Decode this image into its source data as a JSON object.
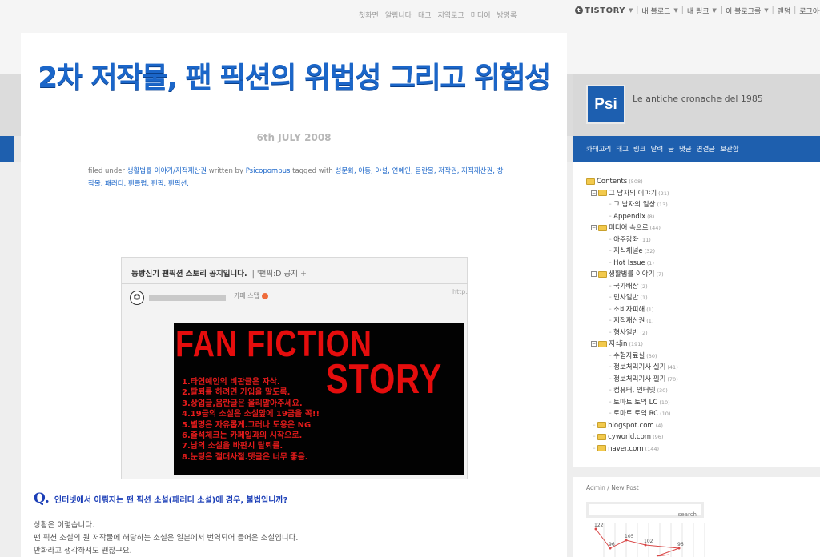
{
  "top_nav": [
    "첫화면",
    "알림니다",
    "태그",
    "지역로그",
    "미디어",
    "방명록"
  ],
  "tistory_bar": {
    "logo": "TISTORY",
    "items": [
      "내 블로그",
      "내 링크",
      "이 블로그를",
      "랜덤",
      "로그아웃"
    ]
  },
  "post": {
    "title": "2차 저작물, 팬 픽션의 위법성 그리고 위험성",
    "date": "6th JULY 2008",
    "meta_filed_label": "filed under",
    "category": "생활법률 이야기/지적재산권",
    "written_by_label": "written by",
    "author": "Psicopompus",
    "tagged_label": "tagged with",
    "tags": [
      "성문화,",
      "야동,",
      "야설,",
      "연예인,",
      "음란물,",
      "저작권,",
      "지적재산권,",
      "창작물,",
      "패러디,",
      "팬클럽,",
      "팬픽,",
      "팬픽션."
    ]
  },
  "embed": {
    "header_title": "동방신기 팬픽션 스토리 공지입니다.",
    "header_sub": "| '팬픽:D 공지 +",
    "cafe_meta": "카페 스탭",
    "url_fragment": "http:",
    "poster_line1": "FAN FICTION",
    "poster_line2": "STORY",
    "rules": [
      "1.타연예인의 비판글은 자삭.",
      "2.탈퇴를 하려면 가입을 말도록.",
      "3.상업글,음란글은 올리말아주세요.",
      "4.19금의 소설은 소설앞에 19금을 꼭!!",
      "5.별명은 자유롭게.그러나 도용은 NG",
      "6.출석체크는 카페일과의 시작으로.",
      "7.남의 소설을 바판시 탈퇴를.",
      "8.눈팅은 절대사절.댓글은 너무 좋음."
    ]
  },
  "question": {
    "mark": "Q.",
    "text": "인터넷에서 이뤄지는 팬 픽션 소설(패러디 소설)에 경우, 불법입니까?"
  },
  "body_lines": [
    "상황은 이렇습니다.",
    "팬 픽션 소설의 원 저작물에 해당하는 소설은 일본에서 번역되어 들어온 소설입니다.",
    "만화라고 생각하셔도 괜찮구요."
  ],
  "sidebar": {
    "logo_text": "Psi",
    "blog_title": "Le antiche cronache del 1985",
    "nav": [
      "카테고리",
      "태그",
      "링크",
      "달력",
      "글",
      "댓글",
      "연결글",
      "보관함"
    ],
    "tree": [
      {
        "label": "Contents",
        "count": "(508)",
        "level": 0,
        "type": "root"
      },
      {
        "label": "그 남자의 이야기",
        "count": "(21)",
        "level": 1,
        "type": "folder"
      },
      {
        "label": "그 남자의 일상",
        "count": "(13)",
        "level": 2,
        "type": "leaf"
      },
      {
        "label": "Appendix",
        "count": "(8)",
        "level": 2,
        "type": "leaf"
      },
      {
        "label": "미디어 속으로",
        "count": "(44)",
        "level": 1,
        "type": "folder"
      },
      {
        "label": "아주강좌",
        "count": "(11)",
        "level": 2,
        "type": "leaf"
      },
      {
        "label": "지식채널e",
        "count": "(32)",
        "level": 2,
        "type": "leaf"
      },
      {
        "label": "Hot Issue",
        "count": "(1)",
        "level": 2,
        "type": "leaf"
      },
      {
        "label": "생활법률 이야기",
        "count": "(7)",
        "level": 1,
        "type": "folder"
      },
      {
        "label": "국가배상",
        "count": "(2)",
        "level": 2,
        "type": "leaf"
      },
      {
        "label": "민사일반",
        "count": "(1)",
        "level": 2,
        "type": "leaf"
      },
      {
        "label": "소비자피해",
        "count": "(1)",
        "level": 2,
        "type": "leaf"
      },
      {
        "label": "지적재산권",
        "count": "(1)",
        "level": 2,
        "type": "leaf"
      },
      {
        "label": "형사일반",
        "count": "(2)",
        "level": 2,
        "type": "leaf"
      },
      {
        "label": "지식in",
        "count": "(191)",
        "level": 1,
        "type": "folder"
      },
      {
        "label": "수험자료실",
        "count": "(30)",
        "level": 2,
        "type": "leaf"
      },
      {
        "label": "정보처리기사 실기",
        "count": "(41)",
        "level": 2,
        "type": "leaf"
      },
      {
        "label": "정보처리기사 필기",
        "count": "(70)",
        "level": 2,
        "type": "leaf"
      },
      {
        "label": "컴퓨터, 인터넷",
        "count": "(30)",
        "level": 2,
        "type": "leaf"
      },
      {
        "label": "토마토 토익 LC",
        "count": "(10)",
        "level": 2,
        "type": "leaf"
      },
      {
        "label": "토마토 토익 RC",
        "count": "(10)",
        "level": 2,
        "type": "leaf"
      },
      {
        "label": "blogspot.com",
        "count": "(4)",
        "level": 1,
        "type": "folder-plain"
      },
      {
        "label": "cyworld.com",
        "count": "(96)",
        "level": 1,
        "type": "folder-plain"
      },
      {
        "label": "naver.com",
        "count": "(144)",
        "level": 1,
        "type": "folder-plain"
      }
    ],
    "admin_label": "Admin / New Post",
    "search_placeholder": "search",
    "visitor_values": [
      "122",
      "96",
      "105",
      "102",
      "96"
    ]
  },
  "colors": {
    "accent": "#1e5fae",
    "title_blue": "#1b66c9",
    "poster_red": "#e50d0d"
  }
}
